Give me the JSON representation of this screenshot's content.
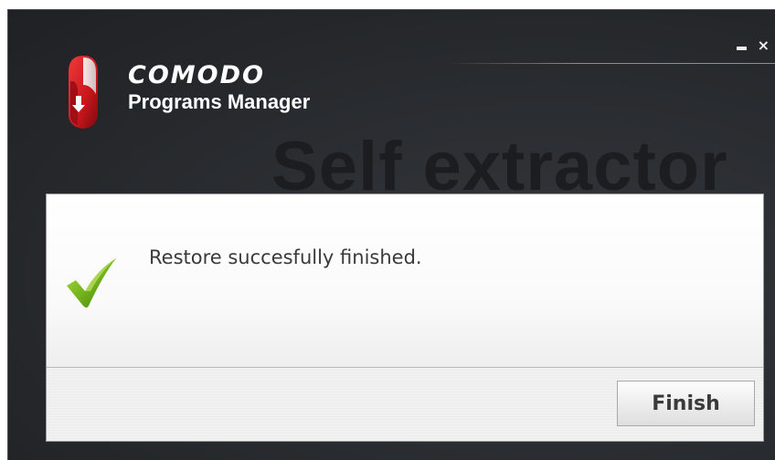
{
  "window": {
    "controls": {
      "minimize_label": "",
      "close_label": "×"
    }
  },
  "branding": {
    "name": "COMODO",
    "product": "Programs Manager",
    "logo_icon": "comodo-shield-icon",
    "accent_color": "#c8161d"
  },
  "watermark": {
    "text": "Self extractor"
  },
  "dialog": {
    "status_icon": "checkmark-icon",
    "status_color": "#6aaa14",
    "message": "Restore succesfully finished.",
    "finish_label": "Finish"
  }
}
